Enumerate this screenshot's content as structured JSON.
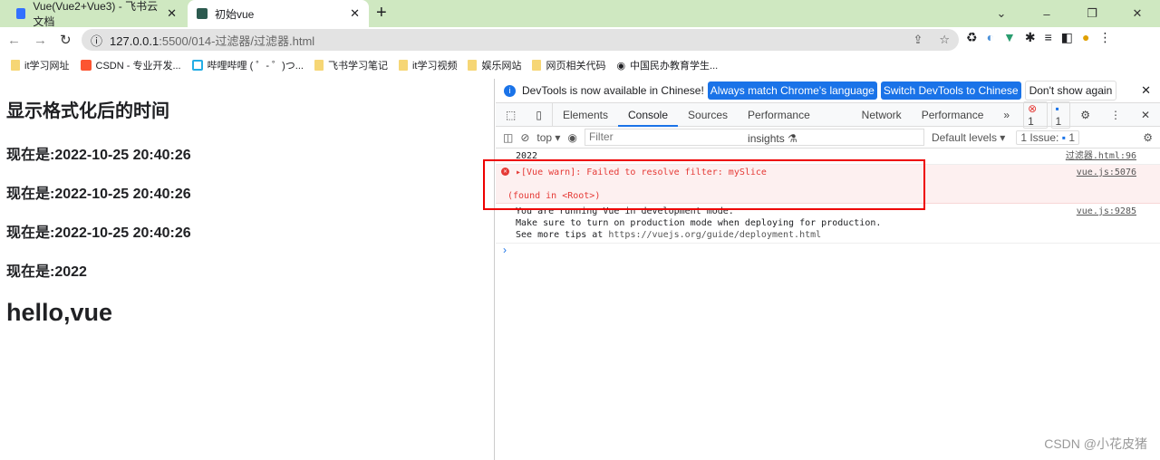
{
  "browser": {
    "tabs": [
      {
        "title": "Vue(Vue2+Vue3) - 飞书云文档",
        "icon": "doc-icon"
      },
      {
        "title": "初始vue",
        "icon": "vue-favicon",
        "active": true
      }
    ],
    "url_host": "127.0.0.1",
    "url_path": ":5500/014-过滤器/过滤器.html",
    "bookmarks": [
      "it学习网址",
      "CSDN - 专业开发...",
      "哔哩哔哩 ( ゜- ゜)つ...",
      "飞书学习笔记",
      "it学习视频",
      "娱乐网站",
      "网页相关代码",
      "中国民办教育学生..."
    ]
  },
  "page": {
    "heading": "显示格式化后的时间",
    "lines": [
      "现在是:2022-10-25 20:40:26",
      "现在是:2022-10-25 20:40:26",
      "现在是:2022-10-25 20:40:26",
      "现在是:2022"
    ],
    "hello": "hello,vue"
  },
  "devtools": {
    "info": {
      "text": "DevTools is now available in Chinese!",
      "btn1": "Always match Chrome's language",
      "btn2": "Switch DevTools to Chinese",
      "btn3": "Don't show again"
    },
    "tabs": [
      "Elements",
      "Console",
      "Sources",
      "Performance insights ⚗",
      "Network",
      "Performance"
    ],
    "error_count": "1",
    "message_count": "1",
    "context": "top ▾",
    "filter_placeholder": "Filter",
    "levels": "Default levels ▾",
    "issues": "1 Issue:",
    "issues_count": "1",
    "messages": [
      {
        "text": "2022",
        "src": "过滤器.html:96"
      },
      {
        "text": "▸[Vue warn]: Failed to resolve filter: mySlice",
        "text2": "(found in <Root>)",
        "src": "vue.js:5076",
        "level": "error"
      },
      {
        "lines": [
          "You are running Vue in development mode.",
          "Make sure to turn on production mode when deploying for production.",
          "See more tips at "
        ],
        "link": "https://vuejs.org/guide/deployment.html",
        "src": "vue.js:9285"
      }
    ]
  },
  "watermark": "CSDN @小花皮猪"
}
